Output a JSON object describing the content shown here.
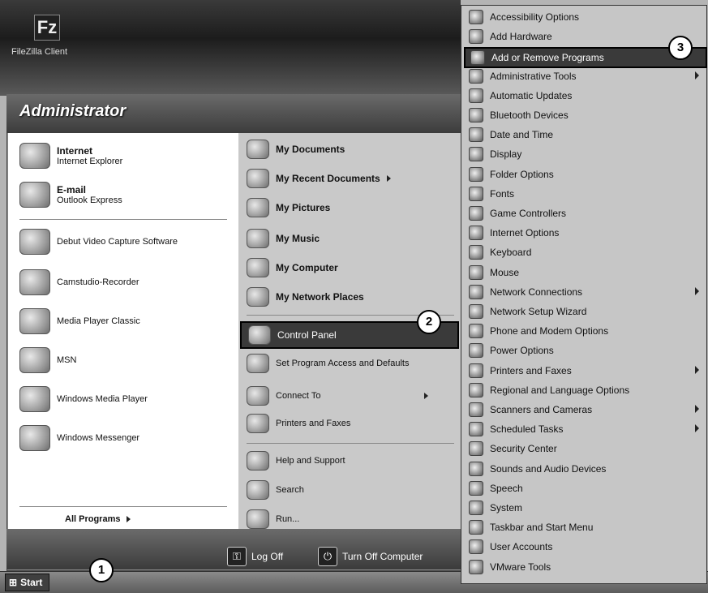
{
  "desktop": {
    "icon_label": "FileZilla Client",
    "icon_glyph": "Fz"
  },
  "start_menu": {
    "user_name": "Administrator",
    "pinned": [
      {
        "title": "Internet",
        "subtitle": "Internet Explorer",
        "icon": "internet-explorer-icon"
      },
      {
        "title": "E-mail",
        "subtitle": "Outlook Express",
        "icon": "outlook-express-icon"
      }
    ],
    "recent": [
      {
        "title": "Debut Video Capture Software",
        "icon": "debut-video-icon"
      },
      {
        "title": "Camstudio-Recorder",
        "icon": "camstudio-icon"
      },
      {
        "title": "Media Player Classic",
        "icon": "media-player-classic-icon"
      },
      {
        "title": "MSN",
        "icon": "msn-icon"
      },
      {
        "title": "Windows Media Player",
        "icon": "windows-media-player-icon"
      },
      {
        "title": "Windows Messenger",
        "icon": "windows-messenger-icon"
      }
    ],
    "all_programs": "All Programs",
    "places": [
      {
        "title": "My Documents",
        "icon": "folder-icon"
      },
      {
        "title": "My Recent Documents",
        "icon": "folder-icon"
      },
      {
        "title": "My Pictures",
        "icon": "folder-icon"
      },
      {
        "title": "My Music",
        "icon": "folder-icon"
      },
      {
        "title": "My Computer",
        "icon": "computer-icon"
      },
      {
        "title": "My Network Places",
        "icon": "network-icon"
      }
    ],
    "system": [
      {
        "title": "Control Panel",
        "icon": "control-panel-icon"
      },
      {
        "title": "Set Program Access and Defaults",
        "icon": "program-access-icon"
      },
      {
        "title": "Connect To",
        "icon": "connect-icon"
      },
      {
        "title": "Printers and Faxes",
        "icon": "printer-icon"
      }
    ],
    "help": [
      {
        "title": "Help and Support",
        "icon": "help-icon"
      },
      {
        "title": "Search",
        "icon": "search-icon"
      },
      {
        "title": "Run...",
        "icon": "run-icon"
      }
    ],
    "log_off": "Log Off",
    "turn_off": "Turn Off Computer"
  },
  "taskbar": {
    "start_label": "Start"
  },
  "callouts": [
    "1",
    "2",
    "3"
  ],
  "control_panel": [
    "Accessibility Options",
    "Add Hardware",
    "Add or Remove Programs",
    "Administrative Tools",
    "Automatic Updates",
    "Bluetooth Devices",
    "Date and Time",
    "Display",
    "Folder Options",
    "Fonts",
    "Game Controllers",
    "Internet Options",
    "Keyboard",
    "Mouse",
    "Network Connections",
    "Network Setup Wizard",
    "Phone and Modem Options",
    "Power Options",
    "Printers and Faxes",
    "Regional and Language Options",
    "Scanners and Cameras",
    "Scheduled Tasks",
    "Security Center",
    "Sounds and Audio Devices",
    "Speech",
    "System",
    "Taskbar and Start Menu",
    "User Accounts",
    "VMware Tools"
  ],
  "colors": {
    "highlight": "#3a3a3a",
    "menu_header": "#4a4a4a"
  }
}
